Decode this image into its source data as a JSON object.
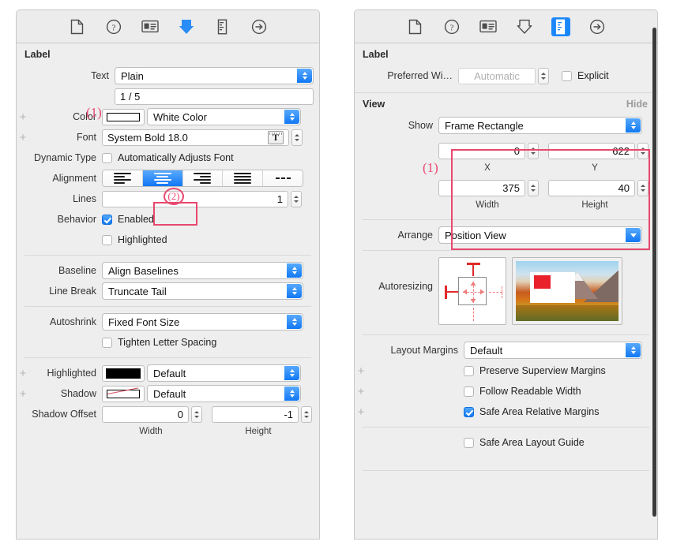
{
  "left_panel": {
    "toolbar": {
      "icons": [
        {
          "name": "file-icon",
          "selected": false
        },
        {
          "name": "help-icon",
          "selected": false
        },
        {
          "name": "identity-card-icon",
          "selected": false
        },
        {
          "name": "attributes-arrow-icon",
          "selected": true
        },
        {
          "name": "ruler-icon",
          "selected": false
        },
        {
          "name": "connections-arrow-icon",
          "selected": false
        }
      ]
    },
    "section_title": "Label",
    "text_row": {
      "label": "Text",
      "value": "Plain"
    },
    "text_value_row": {
      "value": "1 / 5",
      "annotation": "(1)"
    },
    "color_row": {
      "label": "Color",
      "value": "White Color"
    },
    "font_row": {
      "label": "Font",
      "value": "System Bold 18.0"
    },
    "dynamic_type_row": {
      "label": "Dynamic Type",
      "checkbox_label": "Automatically Adjusts Font",
      "checked": false
    },
    "alignment_row": {
      "label": "Alignment",
      "segments": [
        "align-left",
        "align-center",
        "align-right",
        "align-justified",
        "align-natural"
      ],
      "selected_index": 1,
      "annotation": "(2)"
    },
    "lines_row": {
      "label": "Lines",
      "value": "1"
    },
    "behavior_row": {
      "label": "Behavior",
      "enabled_label": "Enabled",
      "enabled_checked": true,
      "highlighted_label": "Highlighted",
      "highlighted_checked": false
    },
    "baseline_row": {
      "label": "Baseline",
      "value": "Align Baselines"
    },
    "line_break_row": {
      "label": "Line Break",
      "value": "Truncate Tail"
    },
    "autoshrink_row": {
      "label": "Autoshrink",
      "value": "Fixed Font Size"
    },
    "tighten_row": {
      "checkbox_label": "Tighten Letter Spacing",
      "checked": false
    },
    "highlighted_color_row": {
      "label": "Highlighted",
      "value": "Default"
    },
    "shadow_color_row": {
      "label": "Shadow",
      "value": "Default"
    },
    "shadow_offset_row": {
      "label": "Shadow Offset",
      "width_value": "0",
      "width_caption": "Width",
      "height_value": "-1",
      "height_caption": "Height"
    }
  },
  "right_panel": {
    "toolbar": {
      "icons": [
        {
          "name": "file-icon",
          "selected": false
        },
        {
          "name": "help-icon",
          "selected": false
        },
        {
          "name": "identity-card-icon",
          "selected": false
        },
        {
          "name": "attributes-arrow-icon",
          "selected": false
        },
        {
          "name": "ruler-icon",
          "selected": true
        },
        {
          "name": "connections-arrow-icon",
          "selected": false
        }
      ]
    },
    "section_title": "Label",
    "preferred_width_row": {
      "label": "Preferred Wi…",
      "placeholder": "Automatic",
      "explicit_label": "Explicit",
      "explicit_checked": false
    },
    "view_section": {
      "title": "View",
      "hide_label": "Hide"
    },
    "show_row": {
      "label": "Show",
      "value": "Frame Rectangle"
    },
    "frame": {
      "annotation": "(1)",
      "x_value": "0",
      "x_caption": "X",
      "y_value": "622",
      "y_caption": "Y",
      "width_value": "375",
      "width_caption": "Width",
      "height_value": "40",
      "height_caption": "Height"
    },
    "arrange_row": {
      "label": "Arrange",
      "value": "Position View"
    },
    "autoresizing_row": {
      "label": "Autoresizing"
    },
    "layout_margins_row": {
      "label": "Layout Margins",
      "value": "Default"
    },
    "checkbox_rows": [
      {
        "label": "Preserve Superview Margins",
        "checked": false,
        "has_plus": true
      },
      {
        "label": "Follow Readable Width",
        "checked": false,
        "has_plus": true
      },
      {
        "label": "Safe Area Relative Margins",
        "checked": true,
        "has_plus": true
      },
      {
        "label": "Safe Area Layout Guide",
        "checked": false,
        "has_plus": false
      }
    ]
  },
  "colors": {
    "annotation": "#e8486f",
    "accent_blue": "#1b87fb",
    "panel_bg": "#eeeeee"
  }
}
